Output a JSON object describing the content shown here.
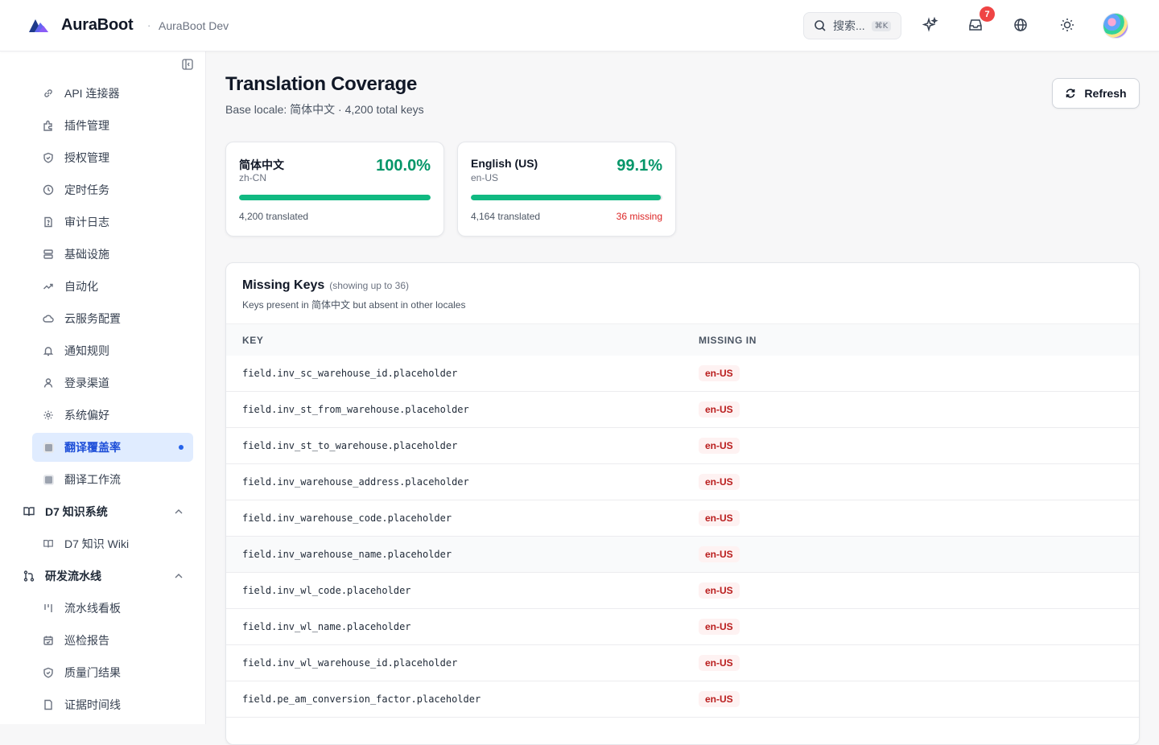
{
  "header": {
    "brand": "AuraBoot",
    "separator": "·",
    "env": "AuraBoot Dev",
    "search_placeholder": "搜索...",
    "search_shortcut": "⌘K",
    "notification_count": "7",
    "icons": [
      "search-icon",
      "sparkles-icon",
      "inbox-icon",
      "globe-icon",
      "sun-icon",
      "avatar"
    ]
  },
  "sidebar": {
    "items": [
      {
        "label": "API 连接器",
        "icon": "link-icon"
      },
      {
        "label": "插件管理",
        "icon": "puzzle-icon"
      },
      {
        "label": "授权管理",
        "icon": "shield-icon"
      },
      {
        "label": "定时任务",
        "icon": "clock-icon"
      },
      {
        "label": "审计日志",
        "icon": "file-question-icon"
      },
      {
        "label": "基础设施",
        "icon": "server-icon"
      },
      {
        "label": "自动化",
        "icon": "trending-icon"
      },
      {
        "label": "云服务配置",
        "icon": "cloud-icon"
      },
      {
        "label": "通知规则",
        "icon": "bell-icon"
      },
      {
        "label": "登录渠道",
        "icon": "user-icon"
      },
      {
        "label": "系统偏好",
        "icon": "gear-icon"
      },
      {
        "label": "翻译覆盖率",
        "icon": "grid-icon",
        "active": true
      },
      {
        "label": "翻译工作流",
        "icon": "grid-icon"
      }
    ],
    "groups": [
      {
        "label": "D7 知识系统",
        "icon": "book-icon",
        "children": [
          {
            "label": "D7 知识 Wiki",
            "icon": "book-icon"
          }
        ]
      },
      {
        "label": "研发流水线",
        "icon": "git-icon",
        "children": [
          {
            "label": "流水线看板",
            "icon": "columns-icon"
          },
          {
            "label": "巡检报告",
            "icon": "calendar-check-icon"
          },
          {
            "label": "质量门结果",
            "icon": "shield-icon"
          },
          {
            "label": "证据时间线",
            "icon": "file-icon"
          }
        ]
      }
    ]
  },
  "page": {
    "title": "Translation Coverage",
    "subtitle": "Base locale: 简体中文 · 4,200 total keys",
    "refresh_label": "Refresh"
  },
  "locales": [
    {
      "name": "简体中文",
      "code": "zh-CN",
      "pct": "100.0%",
      "fill": 1.0,
      "translated": "4,200 translated",
      "missing": ""
    },
    {
      "name": "English (US)",
      "code": "en-US",
      "pct": "99.1%",
      "fill": 0.991,
      "translated": "4,164 translated",
      "missing": "36 missing"
    }
  ],
  "missing": {
    "title": "Missing Keys",
    "note": "(showing up to 36)",
    "description": "Keys present in 简体中文 but absent in other locales",
    "col_key": "KEY",
    "col_missing": "MISSING IN",
    "rows": [
      {
        "key": "field.inv_sc_warehouse_id.placeholder",
        "missing_in": "en-US"
      },
      {
        "key": "field.inv_st_from_warehouse.placeholder",
        "missing_in": "en-US"
      },
      {
        "key": "field.inv_st_to_warehouse.placeholder",
        "missing_in": "en-US"
      },
      {
        "key": "field.inv_warehouse_address.placeholder",
        "missing_in": "en-US"
      },
      {
        "key": "field.inv_warehouse_code.placeholder",
        "missing_in": "en-US"
      },
      {
        "key": "field.inv_warehouse_name.placeholder",
        "missing_in": "en-US"
      },
      {
        "key": "field.inv_wl_code.placeholder",
        "missing_in": "en-US"
      },
      {
        "key": "field.inv_wl_name.placeholder",
        "missing_in": "en-US"
      },
      {
        "key": "field.inv_wl_warehouse_id.placeholder",
        "missing_in": "en-US"
      },
      {
        "key": "field.pe_am_conversion_factor.placeholder",
        "missing_in": "en-US"
      },
      {
        "key": "",
        "missing_in": ""
      }
    ]
  },
  "colors": {
    "accent": "#2563eb",
    "success": "#10b981",
    "danger": "#dc2626"
  }
}
